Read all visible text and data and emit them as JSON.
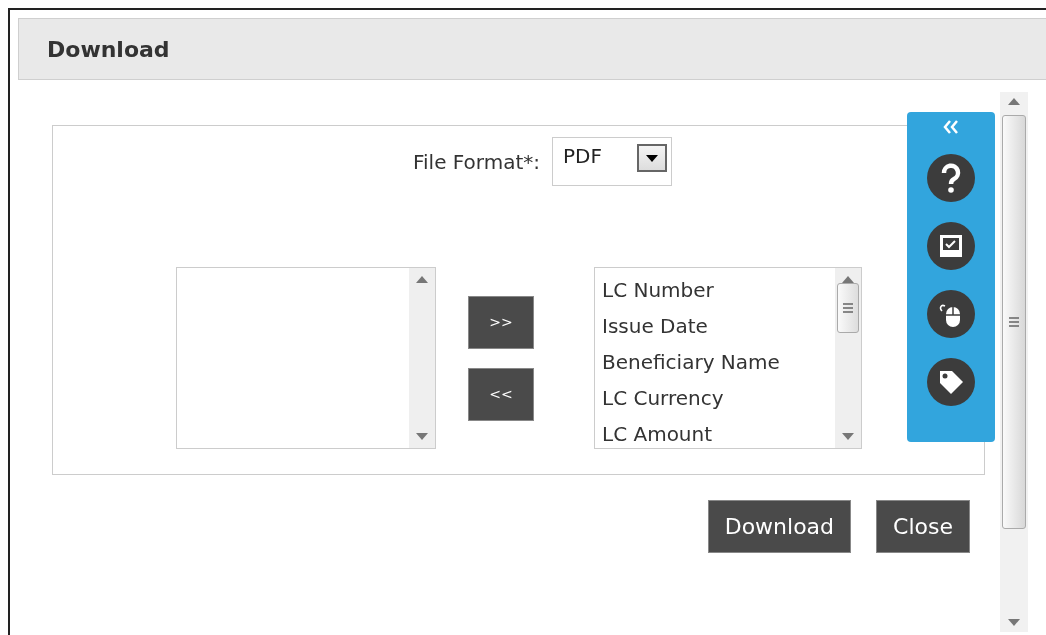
{
  "dialog": {
    "title": "Download"
  },
  "file_format": {
    "label": "File Format*:",
    "value": "PDF"
  },
  "selected_columns": [
    "LC Number",
    "Issue Date",
    "Beneficiary Name",
    "LC Currency",
    "LC Amount"
  ],
  "move_buttons": [
    ">>",
    "<<"
  ],
  "actions": [
    "Download",
    "Close"
  ]
}
